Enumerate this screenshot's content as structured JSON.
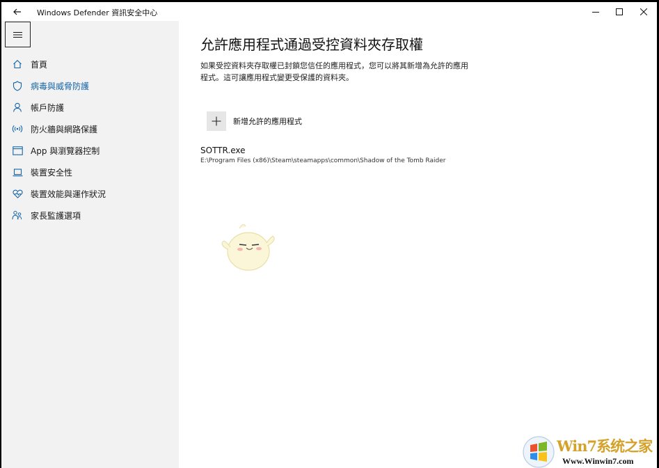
{
  "window": {
    "title": "Windows Defender 資訊安全中心"
  },
  "sidebar": {
    "items": [
      {
        "label": "首頁",
        "icon": "home-icon",
        "active": false
      },
      {
        "label": "病毒與威脅防護",
        "icon": "shield-icon",
        "active": true
      },
      {
        "label": "帳戶防護",
        "icon": "person-icon",
        "active": false
      },
      {
        "label": "防火牆與網路保護",
        "icon": "wireless-icon",
        "active": false
      },
      {
        "label": "App 與瀏覽器控制",
        "icon": "app-window-icon",
        "active": false
      },
      {
        "label": "裝置安全性",
        "icon": "laptop-icon",
        "active": false
      },
      {
        "label": "裝置效能與運作狀況",
        "icon": "heart-icon",
        "active": false
      },
      {
        "label": "家長監護選項",
        "icon": "family-icon",
        "active": false
      }
    ]
  },
  "main": {
    "title": "允許應用程式通過受控資料夾存取權",
    "description": "如果受控資料夾存取權已封鎖您信任的應用程式，您可以將其新增為允許的應用程式。這可讓應用程式變更受保護的資料夾。",
    "add_button_label": "新增允許的應用程式",
    "apps": [
      {
        "name": "SOTTR.exe",
        "path": "E:\\Program Files (x86)\\Steam\\steamapps\\common\\Shadow of the Tomb Raider"
      }
    ]
  },
  "watermark": {
    "brand_text": "Win7系统之家",
    "url": "Www.Winwin7.com"
  },
  "colors": {
    "accent": "#1565a8",
    "sidebar_bg": "#f2f2f2",
    "add_button_bg": "#e6e6e6"
  }
}
